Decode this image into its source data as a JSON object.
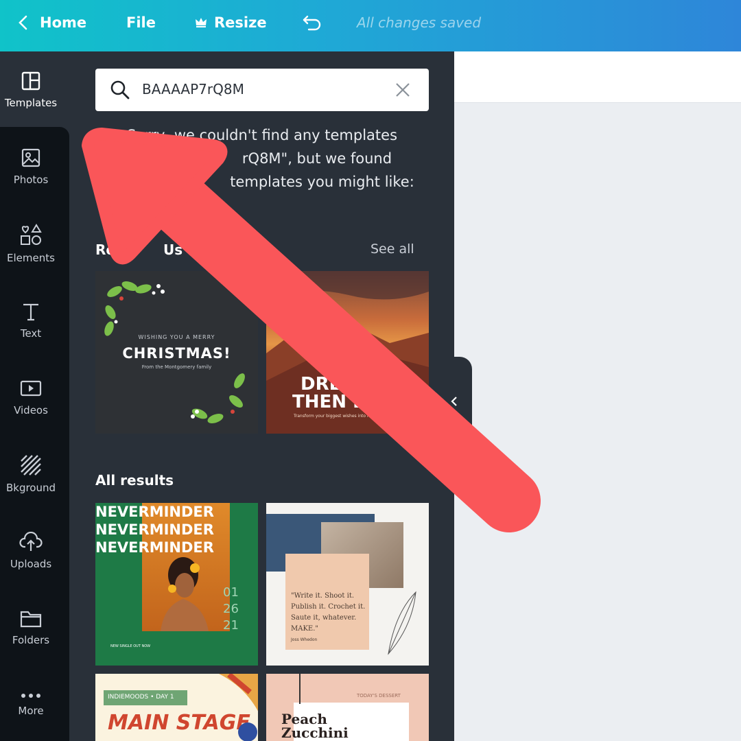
{
  "topbar": {
    "home_label": "Home",
    "file_label": "File",
    "resize_label": "Resize",
    "saved_status": "All changes saved"
  },
  "rail": {
    "items": [
      {
        "label": "Templates",
        "icon": "templates-icon"
      },
      {
        "label": "Photos",
        "icon": "photo-icon"
      },
      {
        "label": "Elements",
        "icon": "shapes-icon"
      },
      {
        "label": "Text",
        "icon": "text-icon"
      },
      {
        "label": "Videos",
        "icon": "video-icon"
      },
      {
        "label": "Bkground",
        "icon": "background-icon"
      },
      {
        "label": "Uploads",
        "icon": "upload-icon"
      },
      {
        "label": "Folders",
        "icon": "folder-icon"
      },
      {
        "label": "More",
        "icon": "more-icon"
      }
    ]
  },
  "search": {
    "value": "BAAAAP7rQ8M"
  },
  "message": {
    "line1": "Sorry, we couldn't find any templates",
    "line2": "rQ8M\", but we found",
    "line3": "templates you might like:"
  },
  "recent": {
    "title_partial_a": "Re",
    "title_partial_b": "Us",
    "see_all": "See all",
    "cards": [
      {
        "line_top": "WISHING YOU A MERRY",
        "headline": "CHRISTMAS!",
        "sub": "From the Montgomery family"
      },
      {
        "headline_1": "DRE",
        "headline_2": "THEN D",
        "sub": "Transform your biggest wishes into reality"
      }
    ]
  },
  "all_results": {
    "title": "All results",
    "cards": [
      {
        "lines": [
          "NEVERMINDER",
          "NEVERMINDER",
          "NEVERMINDER"
        ],
        "date": [
          "01",
          "26",
          "21"
        ],
        "footer": "NEW SINGLE OUT NOW"
      },
      {
        "quote": [
          "\"Write it. Shoot it.",
          "Publish it. Crochet it.",
          "Saute it, whatever.",
          "MAKE.\""
        ],
        "author": "Joss Whedon"
      },
      {
        "tag": "INDIEMOODS • DAY 1",
        "headline": "MAIN STAGE"
      },
      {
        "tag": "TODAY'S DESSERT",
        "headline": [
          "Peach",
          "Zucchini"
        ]
      }
    ]
  },
  "colors": {
    "accent_arrow": "#fa5659",
    "panel": "#293039",
    "rail": "#0e1318"
  }
}
